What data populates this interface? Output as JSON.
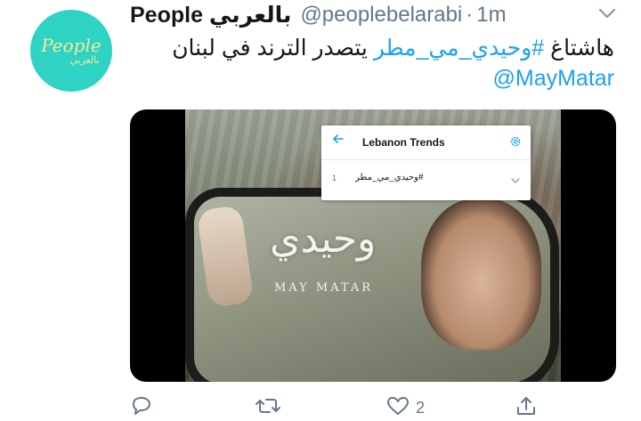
{
  "tweet": {
    "display_name": "People بالعربي",
    "handle": "@peoplebelarabi",
    "separator": "·",
    "time": "1m",
    "text_prefix": "هاشتاغ ",
    "hashtag": "#وحيدي_مي_مطر",
    "text_suffix": " يتصدر الترند في لبنان",
    "mention": "@MayMatar"
  },
  "avatar": {
    "logo_main": "People",
    "logo_sub": "بالعربي"
  },
  "media": {
    "title_ar": "وحيدي",
    "title_en": "MAY MATAR",
    "trends_card": {
      "title": "Lebanon Trends",
      "trends": [
        {
          "rank": "1",
          "name": "#وحيدي_مي_مطر"
        }
      ]
    }
  },
  "actions": {
    "reply_count": "",
    "retweet_count": "",
    "like_count": "2",
    "share_count": ""
  },
  "colors": {
    "accent": "#1da1f2",
    "secondary_text": "#657786",
    "avatar_bg": "#2ed3c3"
  },
  "icons": [
    "chevron-down-icon",
    "back-arrow-icon",
    "gear-icon",
    "reply-icon",
    "retweet-icon",
    "like-icon",
    "share-icon"
  ]
}
